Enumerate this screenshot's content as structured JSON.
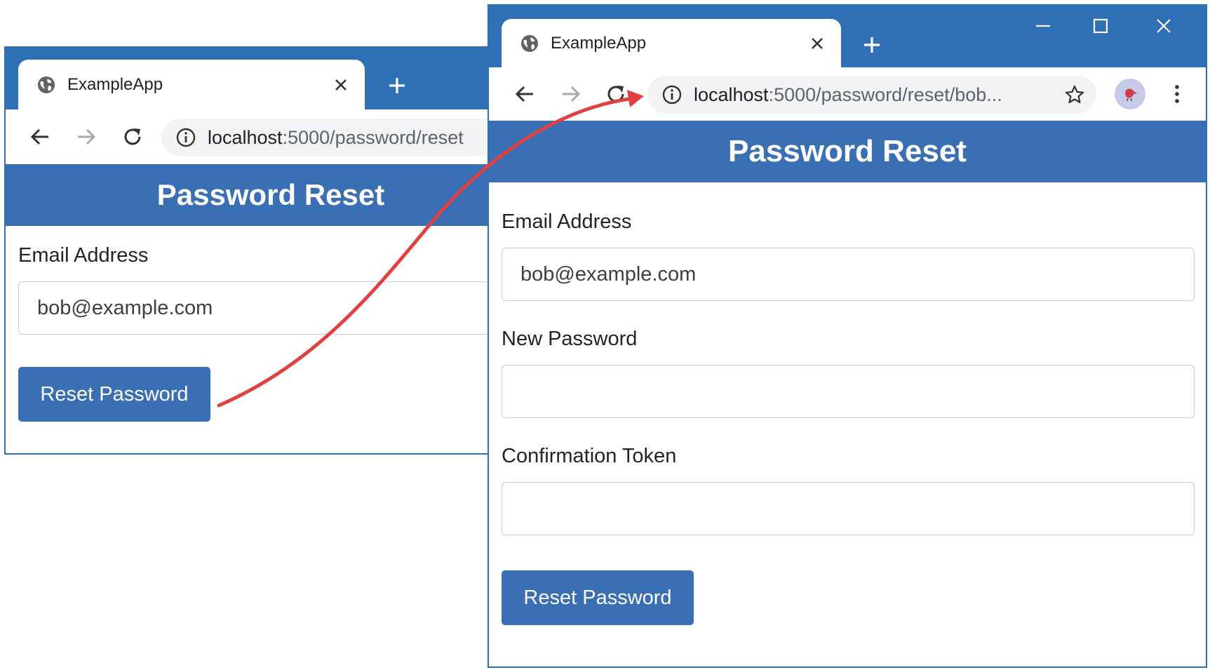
{
  "window_before": {
    "tab_title": "ExampleApp",
    "url_host": "localhost",
    "url_path": ":5000/password/reset",
    "header": "Password Reset",
    "email_label": "Email Address",
    "email_value": "bob@example.com",
    "button_label": "Reset Password"
  },
  "window_after": {
    "tab_title": "ExampleApp",
    "url_host": "localhost",
    "url_path": ":5000/password/reset/bob...",
    "header": "Password Reset",
    "email_label": "Email Address",
    "email_value": "bob@example.com",
    "password_label": "New Password",
    "password_value": "",
    "token_label": "Confirmation Token",
    "token_value": "",
    "button_label": "Reset Password"
  },
  "icons": {
    "tab_favicon": "globe-icon",
    "tab_close": "close-icon",
    "new_tab": "plus-icon",
    "back": "arrow-left-icon",
    "forward": "arrow-right-icon",
    "reload": "reload-icon",
    "site_info": "info-icon",
    "bookmark": "star-icon",
    "profile": "avatar-icon",
    "menu": "kebab-menu-icon",
    "minimize": "minimize-icon",
    "maximize": "maximize-icon",
    "close_window": "close-icon"
  },
  "colors": {
    "chrome_blue": "#2f6fb5",
    "header_blue": "#3a6fb3",
    "arrow_red": "#e04040"
  }
}
